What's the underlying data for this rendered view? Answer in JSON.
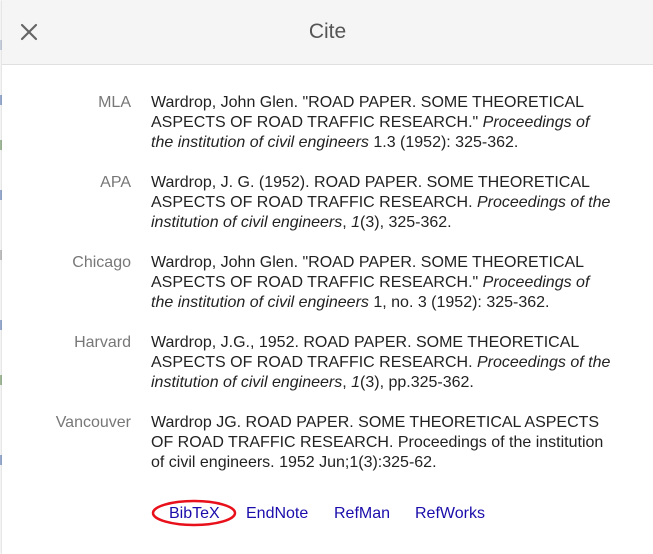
{
  "dialog": {
    "title": "Cite",
    "close_icon": "close-icon"
  },
  "citations": [
    {
      "style": "MLA",
      "parts": [
        {
          "text": "Wardrop, John Glen. \"ROAD PAPER. SOME THEORETICAL ASPECTS OF ROAD TRAFFIC RESEARCH.\" ",
          "italic": false
        },
        {
          "text": "Proceedings of the institution of civil engineers",
          "italic": true
        },
        {
          "text": " 1.3 (1952): 325-362.",
          "italic": false
        }
      ]
    },
    {
      "style": "APA",
      "parts": [
        {
          "text": "Wardrop, J. G. (1952). ROAD PAPER. SOME THEORETICAL ASPECTS OF ROAD TRAFFIC RESEARCH. ",
          "italic": false
        },
        {
          "text": "Proceedings of the institution of civil engineers",
          "italic": true
        },
        {
          "text": ", ",
          "italic": false
        },
        {
          "text": "1",
          "italic": true
        },
        {
          "text": "(3), 325-362.",
          "italic": false
        }
      ]
    },
    {
      "style": "Chicago",
      "parts": [
        {
          "text": "Wardrop, John Glen. \"ROAD PAPER. SOME THEORETICAL ASPECTS OF ROAD TRAFFIC RESEARCH.\" ",
          "italic": false
        },
        {
          "text": "Proceedings of the institution of civil engineers",
          "italic": true
        },
        {
          "text": " 1, no. 3 (1952): 325-362.",
          "italic": false
        }
      ]
    },
    {
      "style": "Harvard",
      "parts": [
        {
          "text": "Wardrop, J.G., 1952. ROAD PAPER. SOME THEORETICAL ASPECTS OF ROAD TRAFFIC RESEARCH. ",
          "italic": false
        },
        {
          "text": "Proceedings of the institution of civil engineers",
          "italic": true
        },
        {
          "text": ", ",
          "italic": false
        },
        {
          "text": "1",
          "italic": true
        },
        {
          "text": "(3), pp.325-362.",
          "italic": false
        }
      ]
    },
    {
      "style": "Vancouver",
      "parts": [
        {
          "text": "Wardrop JG. ROAD PAPER. SOME THEORETICAL ASPECTS OF ROAD TRAFFIC RESEARCH. Proceedings of the institution of civil engineers. 1952 Jun;1(3):325-62.",
          "italic": false
        }
      ]
    }
  ],
  "export_links": [
    {
      "label": "BibTeX",
      "highlighted": true
    },
    {
      "label": "EndNote",
      "highlighted": false
    },
    {
      "label": "RefMan",
      "highlighted": false
    },
    {
      "label": "RefWorks",
      "highlighted": false
    }
  ],
  "colors": {
    "link": "#1a0dab",
    "highlight": "#e8101a",
    "label": "#777777",
    "header_bg": "#f5f5f5"
  }
}
